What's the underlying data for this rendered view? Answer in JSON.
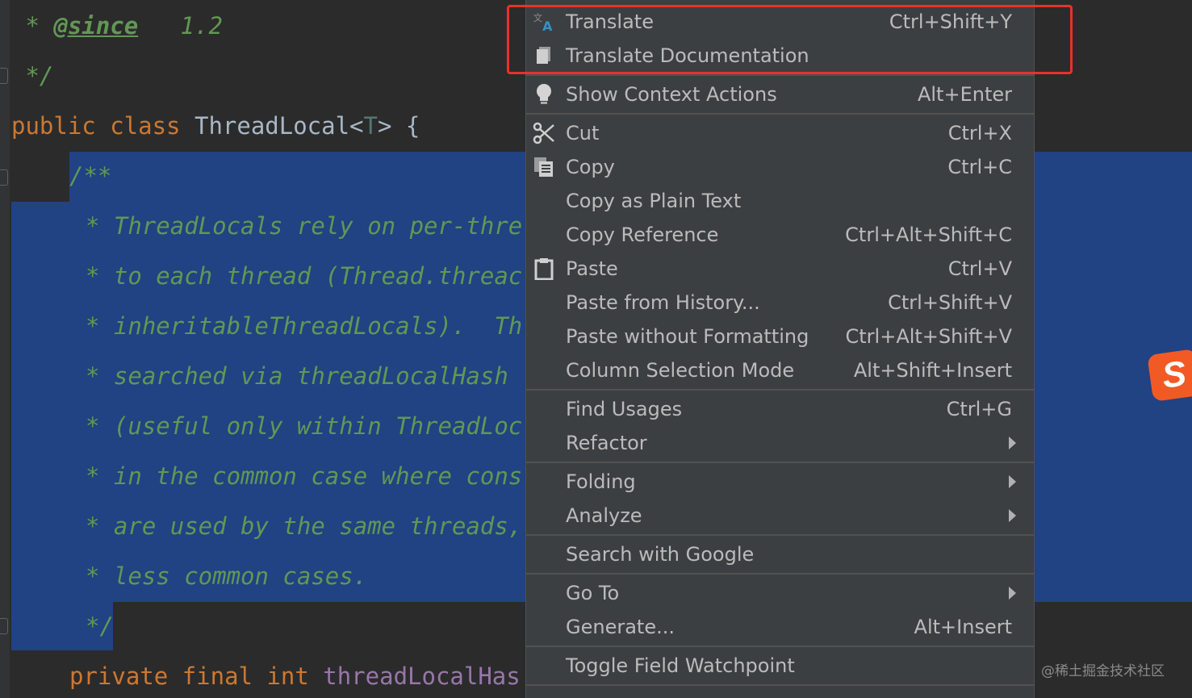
{
  "editor": {
    "lines": [
      {
        "parts": [
          {
            "t": " * ",
            "c": "doc"
          },
          {
            "t": "@since",
            "c": "tag"
          },
          {
            "t": "   1.2",
            "c": "doc"
          }
        ]
      },
      {
        "parts": [
          {
            "t": " */",
            "c": "doc"
          }
        ]
      },
      {
        "parts": [
          {
            "t": "public ",
            "c": "kw"
          },
          {
            "t": "class ",
            "c": "kw"
          },
          {
            "t": "ThreadLocal<",
            "c": "plain"
          },
          {
            "t": "T",
            "c": "tparam"
          },
          {
            "t": "> {",
            "c": "plain"
          }
        ]
      },
      {
        "parts": [
          {
            "t": "/**",
            "c": "doc"
          }
        ]
      },
      {
        "parts": [
          {
            "t": "* ThreadLocals rely on per-thre",
            "c": "doc"
          }
        ]
      },
      {
        "parts": [
          {
            "t": "* to each thread (Thread.threac",
            "c": "doc"
          }
        ]
      },
      {
        "parts": [
          {
            "t": "* inheritableThreadLocals).  Th",
            "c": "doc"
          }
        ]
      },
      {
        "parts": [
          {
            "t": "* searched via threadLocalHash",
            "c": "doc"
          }
        ]
      },
      {
        "parts": [
          {
            "t": "* (useful only within ThreadLoc",
            "c": "doc"
          }
        ]
      },
      {
        "parts": [
          {
            "t": "* in the common case where cons",
            "c": "doc"
          }
        ]
      },
      {
        "parts": [
          {
            "t": "* are used by the same threads,",
            "c": "doc"
          }
        ]
      },
      {
        "parts": [
          {
            "t": "* less common cases.",
            "c": "doc"
          }
        ]
      },
      {
        "parts": [
          {
            "t": "*/",
            "c": "doc"
          }
        ]
      },
      {
        "parts": [
          {
            "t": "private ",
            "c": "kw"
          },
          {
            "t": "final ",
            "c": "kw"
          },
          {
            "t": "int ",
            "c": "kw"
          },
          {
            "t": "threadLocalHas",
            "c": "field"
          }
        ]
      }
    ]
  },
  "menu": {
    "items": [
      {
        "label": "Translate",
        "shortcut": "Ctrl+Shift+Y",
        "icon": "translate-icon"
      },
      {
        "label": "Translate Documentation",
        "shortcut": "",
        "icon": "document-icon"
      },
      {
        "label": "Show Context Actions",
        "shortcut": "Alt+Enter",
        "icon": "lightbulb-icon"
      },
      {
        "label": "Cut",
        "shortcut": "Ctrl+X",
        "icon": "scissors-icon"
      },
      {
        "label": "Copy",
        "shortcut": "Ctrl+C",
        "icon": "copy-icon"
      },
      {
        "label": "Copy as Plain Text",
        "shortcut": "",
        "icon": ""
      },
      {
        "label": "Copy Reference",
        "shortcut": "Ctrl+Alt+Shift+C",
        "icon": ""
      },
      {
        "label": "Paste",
        "shortcut": "Ctrl+V",
        "icon": "clipboard-icon"
      },
      {
        "label": "Paste from History...",
        "shortcut": "Ctrl+Shift+V",
        "icon": ""
      },
      {
        "label": "Paste without Formatting",
        "shortcut": "Ctrl+Alt+Shift+V",
        "icon": ""
      },
      {
        "label": "Column Selection Mode",
        "shortcut": "Alt+Shift+Insert",
        "icon": ""
      },
      {
        "label": "Find Usages",
        "shortcut": "Ctrl+G",
        "icon": ""
      },
      {
        "label": "Refactor",
        "shortcut": "",
        "icon": "",
        "submenu": true
      },
      {
        "label": "Folding",
        "shortcut": "",
        "icon": "",
        "submenu": true
      },
      {
        "label": "Analyze",
        "shortcut": "",
        "icon": "",
        "submenu": true
      },
      {
        "label": "Search with Google",
        "shortcut": "",
        "icon": ""
      },
      {
        "label": "Go To",
        "shortcut": "",
        "icon": "",
        "submenu": true
      },
      {
        "label": "Generate...",
        "shortcut": "Alt+Insert",
        "icon": ""
      },
      {
        "label": "Toggle Field Watchpoint",
        "shortcut": "",
        "icon": ""
      }
    ]
  },
  "colors": {
    "highlight_box": "#e8312c",
    "selection": "#214283",
    "menu_bg": "#3c3f41"
  },
  "ime": {
    "glyph": "S"
  },
  "watermark": "@稀土掘金技术社区"
}
